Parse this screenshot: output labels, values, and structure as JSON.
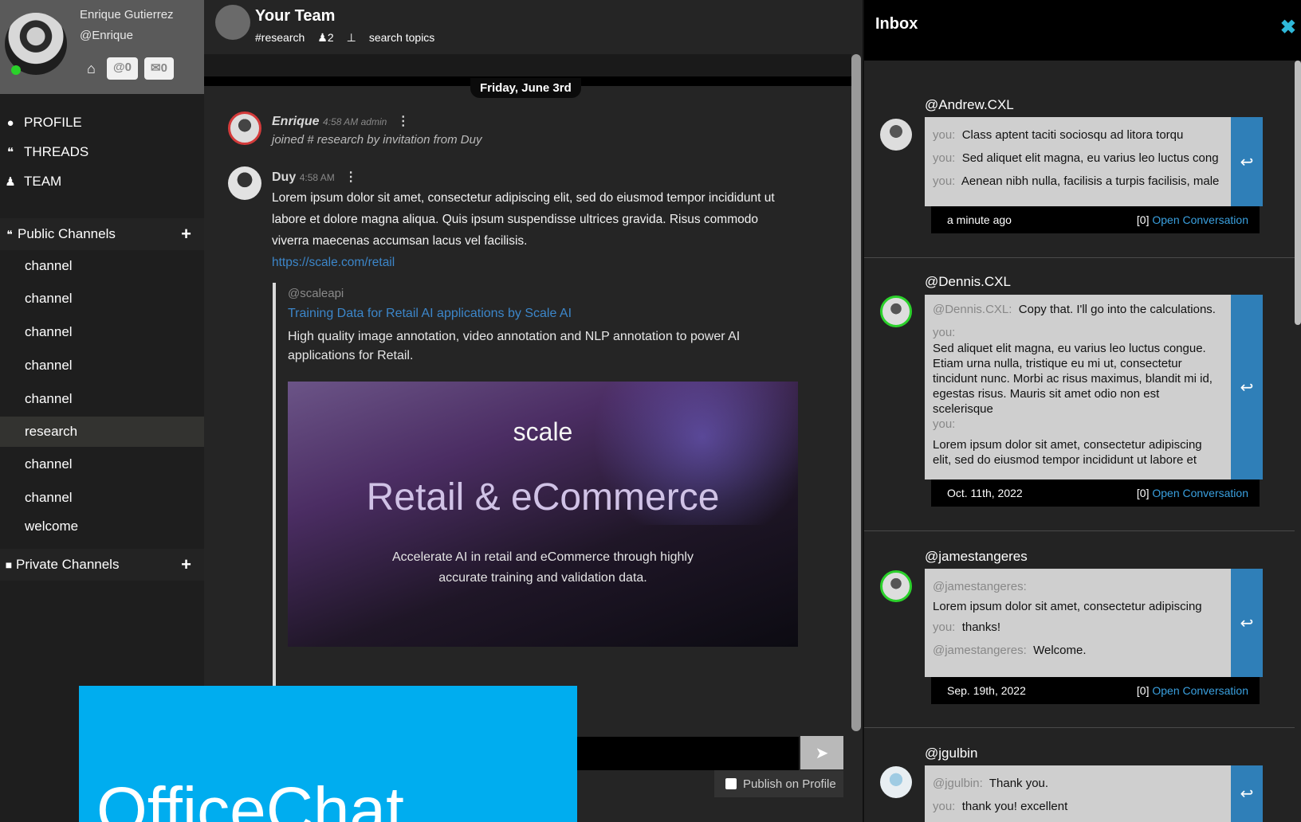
{
  "user": {
    "name": "Enrique Gutierrez",
    "handle": "@Enrique",
    "mentions_badge": "@0",
    "mail_badge": "✉0"
  },
  "nav": [
    {
      "label": "PROFILE",
      "icon": "user-icon"
    },
    {
      "label": "THREADS",
      "icon": "comments-icon"
    },
    {
      "label": "TEAM",
      "icon": "team-icon"
    }
  ],
  "public_channels": {
    "title": "Public Channels",
    "items": [
      "channel",
      "channel",
      "channel",
      "channel",
      "channel",
      "research",
      "channel",
      "channel",
      "welcome"
    ],
    "active": "research"
  },
  "private_channels": {
    "title": "Private Channels"
  },
  "team": {
    "name": "Your Team",
    "channel": "research",
    "members": "2",
    "search": "search topics"
  },
  "date_divider": "Friday, June 3rd",
  "messages": [
    {
      "author": "Enrique",
      "time": "4:58 AM admin",
      "text": "joined # research by invitation from Duy"
    },
    {
      "author": "Duy",
      "time": "4:58 AM",
      "text": "Lorem ipsum dolor sit amet, consectetur adipiscing elit, sed do eiusmod tempor incididunt ut labore et dolore magna aliqua. Quis ipsum suspendisse ultrices gravida. Risus commodo viverra maecenas accumsan lacus vel facilisis.",
      "link": "https://scale.com/retail"
    }
  ],
  "preview": {
    "source": "@scaleapi",
    "title": "Training Data for Retail AI applications by Scale AI",
    "desc": "High quality image annotation, video annotation and NLP annotation to power AI applications for Retail.",
    "brand": "scale",
    "headline": "Retail & eCommerce",
    "sub": "Accelerate AI in retail and eCommerce through highly accurate training and validation data."
  },
  "composer": {
    "publish": "Publish on Profile"
  },
  "overlay": {
    "text": "OfficeChat"
  },
  "inbox": {
    "title": "Inbox",
    "threads": [
      {
        "name": "@Andrew.CXL",
        "lines": [
          {
            "who": "you:",
            "text": "Class aptent taciti sociosqu ad litora torqu"
          },
          {
            "who": "you:",
            "text": "Sed aliquet elit magna, eu varius leo luctus cong"
          },
          {
            "who": "you:",
            "text": "Aenean nibh nulla, facilisis a turpis facilisis, male"
          }
        ],
        "date": "a minute ago",
        "count": "[0]",
        "open": "Open Conversation"
      },
      {
        "name": "@Dennis.CXL",
        "lines": [
          {
            "who": "@Dennis.CXL:",
            "text": "Copy that. I'll go into the calculations."
          },
          {
            "who": "you:",
            "text": "Sed aliquet elit magna, eu varius leo luctus congue. Etiam urna nulla, tristique eu mi ut, consectetur tincidunt nunc. Morbi ac risus maximus, blandit mi id, egestas risus. Mauris sit amet odio non est scelerisque"
          },
          {
            "who": "you:",
            "text": "Lorem ipsum dolor sit amet, consectetur adipiscing elit, sed do eiusmod tempor incididunt ut labore et"
          }
        ],
        "date": "Oct. 11th, 2022",
        "count": "[0]",
        "open": "Open Conversation"
      },
      {
        "name": "@jamestangeres",
        "lines": [
          {
            "who": "@jamestangeres:",
            "text": "Lorem ipsum dolor sit amet, consectetur adipiscing"
          },
          {
            "who": "you:",
            "text": "thanks!"
          },
          {
            "who": "@jamestangeres:",
            "text": "Welcome."
          }
        ],
        "date": "Sep. 19th, 2022",
        "count": "[0]",
        "open": "Open Conversation"
      },
      {
        "name": "@jgulbin",
        "lines": [
          {
            "who": "@jgulbin:",
            "text": "Thank you."
          },
          {
            "who": "you:",
            "text": "thank you! excellent"
          }
        ]
      }
    ]
  }
}
